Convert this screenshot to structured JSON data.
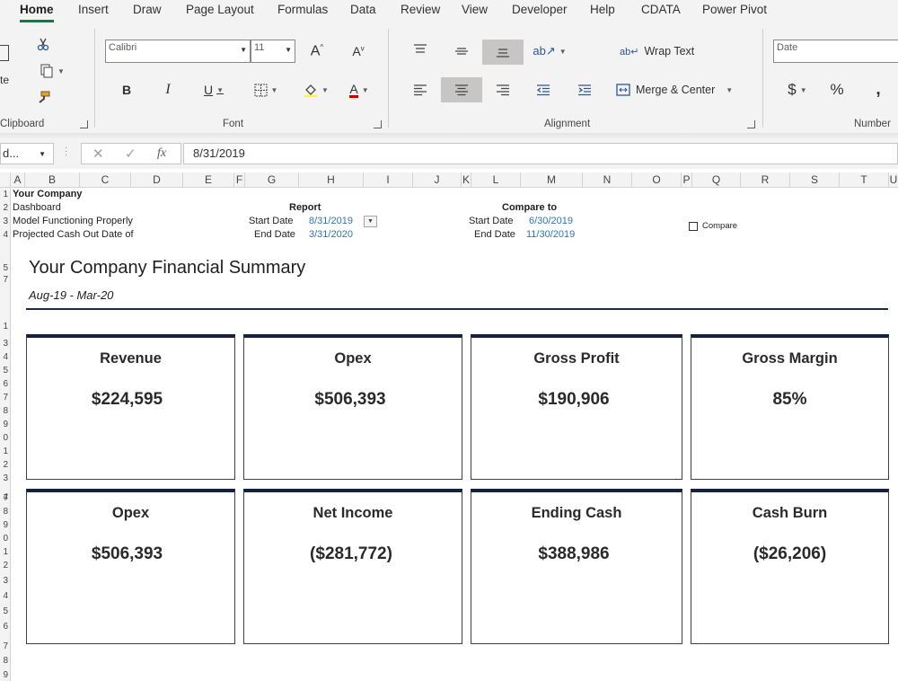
{
  "ribbon": {
    "tabs": [
      "Home",
      "Insert",
      "Draw",
      "Page Layout",
      "Formulas",
      "Data",
      "Review",
      "View",
      "Developer",
      "Help",
      "CDATA",
      "Power Pivot"
    ],
    "active_tab": "Home",
    "clipboard": {
      "label": "Clipboard",
      "paste_partial": "te"
    },
    "font": {
      "label": "Font",
      "name": "Calibri",
      "size": "11"
    },
    "alignment": {
      "label": "Alignment",
      "wrap_text": "Wrap Text",
      "merge_center": "Merge & Center"
    },
    "number": {
      "label": "Number",
      "format": "Date"
    }
  },
  "formula_bar": {
    "name_box": "d...",
    "formula": "8/31/2019"
  },
  "columns": [
    "A",
    "B",
    "C",
    "D",
    "E",
    "F",
    "G",
    "H",
    "I",
    "J",
    "K",
    "L",
    "M",
    "N",
    "O",
    "P",
    "Q",
    "R",
    "S",
    "T",
    "U"
  ],
  "rows": [
    "1",
    "2",
    "3",
    "4",
    "5",
    "7",
    "1",
    "3",
    "4",
    "5",
    "6",
    "7",
    "8",
    "9",
    "0",
    "1",
    "2",
    "3",
    "4",
    "6",
    "7",
    "8",
    "9",
    "0",
    "1",
    "2",
    "3",
    "4",
    "5",
    "6",
    "7",
    "8",
    "9"
  ],
  "sheet": {
    "company": "Your Company",
    "dashboard": "Dashboard",
    "model_status": "Model Functioning Properly",
    "cash_out": "Projected Cash Out Date of",
    "report_label": "Report",
    "compare_label": "Compare to",
    "start_date_label": "Start Date",
    "end_date_label": "End Date",
    "report_start": "8/31/2019",
    "report_end": "3/31/2020",
    "compare_start": "6/30/2019",
    "compare_end": "11/30/2019",
    "compare_checkbox": "Compare",
    "compare_checked": false
  },
  "dashboard": {
    "title": "Your Company Financial Summary",
    "period": "Aug-19 - Mar-20",
    "cards": [
      {
        "title": "Revenue",
        "value": "$224,595"
      },
      {
        "title": "Opex",
        "value": "$506,393"
      },
      {
        "title": "Gross Profit",
        "value": "$190,906"
      },
      {
        "title": "Gross Margin",
        "value": "85%"
      },
      {
        "title": "Opex",
        "value": "$506,393"
      },
      {
        "title": "Net Income",
        "value": "($281,772)"
      },
      {
        "title": "Ending Cash",
        "value": "$388,986"
      },
      {
        "title": "Cash Burn",
        "value": "($26,206)"
      }
    ]
  }
}
